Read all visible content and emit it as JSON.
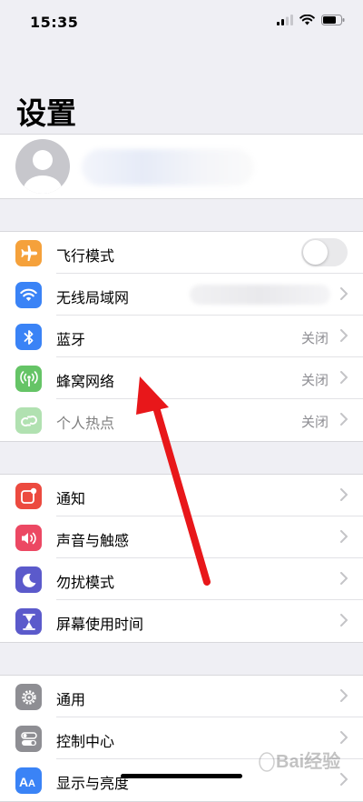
{
  "status": {
    "time": "15:35"
  },
  "page_title": "设置",
  "group1": [
    {
      "label": "飞行模式",
      "icon": "airplane-icon",
      "color": "#f5a13b",
      "control": "toggle",
      "on": false
    },
    {
      "label": "无线局域网",
      "icon": "wifi-icon",
      "color": "#3a83f6",
      "control": "chevron",
      "value_redacted": true
    },
    {
      "label": "蓝牙",
      "icon": "bluetooth-icon",
      "color": "#3a83f6",
      "value": "关闭"
    },
    {
      "label": "蜂窝网络",
      "icon": "antenna-icon",
      "color": "#65c466",
      "value": "关闭"
    },
    {
      "label": "个人热点",
      "icon": "hotspot-icon",
      "color": "#65c466",
      "value": "关闭",
      "disabled": true
    }
  ],
  "group2": [
    {
      "label": "通知",
      "icon": "notification-icon",
      "color": "#ec4a3f"
    },
    {
      "label": "声音与触感",
      "icon": "speaker-icon",
      "color": "#ec4863"
    },
    {
      "label": "勿扰模式",
      "icon": "moon-icon",
      "color": "#5b5acb"
    },
    {
      "label": "屏幕使用时间",
      "icon": "hourglass-icon",
      "color": "#5b5acb"
    }
  ],
  "group3": [
    {
      "label": "通用",
      "icon": "gear-icon",
      "color": "#8e8e93"
    },
    {
      "label": "控制中心",
      "icon": "switches-icon",
      "color": "#8e8e93"
    },
    {
      "label": "显示与亮度",
      "icon": "display-icon",
      "color": "#3a83f6"
    }
  ],
  "watermark": {
    "text": "Bai经验"
  },
  "colors": {
    "background": "#efeff4",
    "arrow": "#e8171a"
  }
}
